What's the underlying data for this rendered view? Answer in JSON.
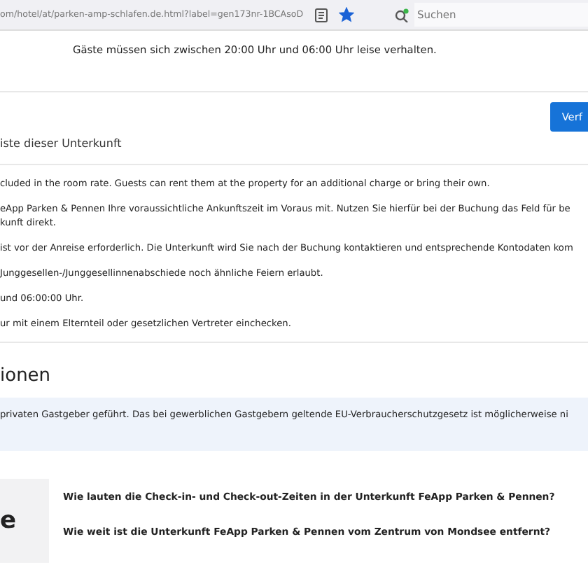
{
  "browser": {
    "url": "om/hotel/at/parken-amp-schlafen.de.html?label=gen173nr-1BCAsoD",
    "bookmarked": true,
    "search": {
      "placeholder": "Suchen"
    }
  },
  "notice": "Gäste müssen sich zwischen 20:00 Uhr und 06:00 Uhr leise verhalten.",
  "button": "Verf",
  "subtitle": "iste dieser Unterkunft",
  "rules": [
    {
      "lines": [
        "cluded in the room rate. Guests can rent them at the property for an additional charge or bring their own."
      ]
    },
    {
      "lines": [
        "eApp Parken & Pennen Ihre voraussichtliche Ankunftszeit im Voraus mit. Nutzen Sie hierfür bei der Buchung das Feld für be",
        "kunft direkt."
      ]
    },
    {
      "lines": [
        "ist vor der Anreise erforderlich. Die Unterkunft wird Sie nach der Buchung kontaktieren und entsprechende Kontodaten kom"
      ]
    },
    {
      "lines": [
        "Junggesellen-/Junggesellinnenabschiede noch ähnliche Feiern erlaubt."
      ]
    },
    {
      "lines": [
        "und 06:00:00 Uhr."
      ]
    },
    {
      "lines": [
        "ur mit einem Elternteil oder gesetzlichen Vertreter einchecken."
      ]
    }
  ],
  "section_heading": "ionen",
  "info": "privaten Gastgeber geführt. Das bei gewerblichen Gastgebern geltende EU-Verbraucherschutzgesetz ist möglicherweise ni",
  "faq": {
    "side_heading": "e",
    "questions": [
      "Wie lauten die Check-in- und Check-out-Zeiten in der Unterkunft FeApp Parken & Pennen?",
      "Wie weit ist die Unterkunft FeApp Parken & Pennen vom Zentrum von Mondsee entfernt?"
    ]
  }
}
